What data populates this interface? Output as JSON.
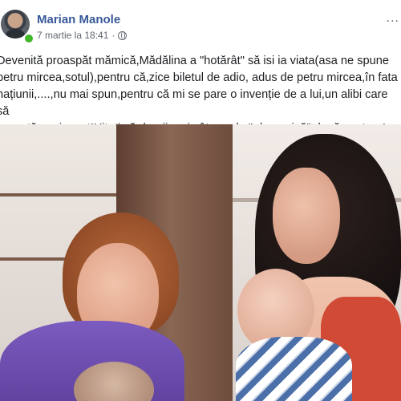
{
  "post": {
    "author": "Marian Manole",
    "timestamp": "7 martie la 18:41",
    "more_label": "...",
    "text": "Devenită proaspăt mămică,Mădălina a \"hotărât\" să isi ia viata(asa ne spune\npetru mircea,sotul),pentru că,zice biletul de adio, adus de petru mircea,în fata\nnațiunii,....,nu mai spun,pentru că mi se pare o invenție de a lui,un alibi care să\nl scoată nevinovat!Uitati vă dragii mei,cât era de \" depresivă\" după naștere!"
  },
  "icons": {
    "globe": "globe-icon",
    "more": "more-icon"
  },
  "colors": {
    "author_blue": "#385898",
    "online_green": "#42b72a"
  }
}
